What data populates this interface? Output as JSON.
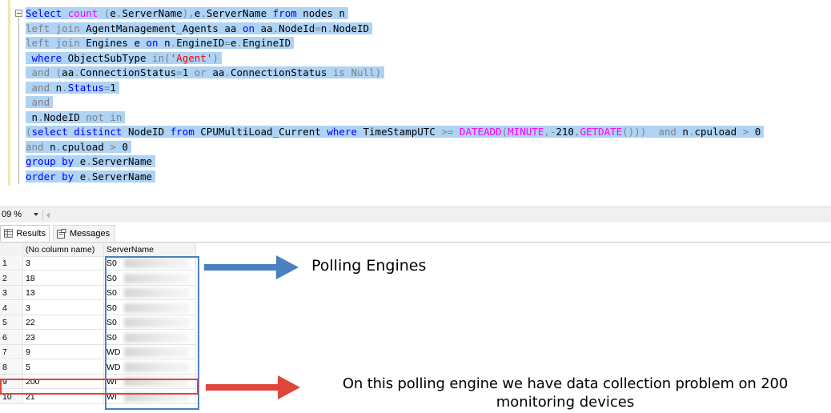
{
  "editor": {
    "lines": [
      [
        {
          "t": "Select ",
          "c": "kw"
        },
        {
          "t": "count",
          "c": "fn"
        },
        {
          "t": " (",
          "c": "gr"
        },
        {
          "t": "e",
          "c": "plain"
        },
        {
          "t": ".",
          "c": "gr"
        },
        {
          "t": "ServerName",
          "c": "plain"
        },
        {
          "t": "),",
          "c": "gr"
        },
        {
          "t": "e",
          "c": "plain"
        },
        {
          "t": ".",
          "c": "gr"
        },
        {
          "t": "ServerName ",
          "c": "plain"
        },
        {
          "t": "from",
          "c": "kw"
        },
        {
          "t": " nodes n",
          "c": "plain"
        }
      ],
      [
        {
          "t": "left join",
          "c": "gr"
        },
        {
          "t": " AgentManagement_Agents aa ",
          "c": "plain"
        },
        {
          "t": "on",
          "c": "kw"
        },
        {
          "t": " aa",
          "c": "plain"
        },
        {
          "t": ".",
          "c": "gr"
        },
        {
          "t": "NodeId",
          "c": "plain"
        },
        {
          "t": "=",
          "c": "gr"
        },
        {
          "t": "n",
          "c": "plain"
        },
        {
          "t": ".",
          "c": "gr"
        },
        {
          "t": "NodeID",
          "c": "plain"
        }
      ],
      [
        {
          "t": "left join",
          "c": "gr"
        },
        {
          "t": " Engines e ",
          "c": "plain"
        },
        {
          "t": "on",
          "c": "kw"
        },
        {
          "t": " n",
          "c": "plain"
        },
        {
          "t": ".",
          "c": "gr"
        },
        {
          "t": "EngineID",
          "c": "plain"
        },
        {
          "t": "=",
          "c": "gr"
        },
        {
          "t": "e",
          "c": "plain"
        },
        {
          "t": ".",
          "c": "gr"
        },
        {
          "t": "EngineID",
          "c": "plain"
        }
      ],
      [
        {
          "t": " where",
          "c": "kw"
        },
        {
          "t": " ObjectSubType ",
          "c": "plain"
        },
        {
          "t": "in",
          "c": "gr"
        },
        {
          "t": "(",
          "c": "gr"
        },
        {
          "t": "'Agent'",
          "c": "str"
        },
        {
          "t": ")",
          "c": "gr"
        }
      ],
      [
        {
          "t": " and",
          "c": "gr"
        },
        {
          "t": " (",
          "c": "gr"
        },
        {
          "t": "aa",
          "c": "plain"
        },
        {
          "t": ".",
          "c": "gr"
        },
        {
          "t": "ConnectionStatus",
          "c": "plain"
        },
        {
          "t": "=",
          "c": "gr"
        },
        {
          "t": "1 ",
          "c": "plain"
        },
        {
          "t": "or",
          "c": "gr"
        },
        {
          "t": " aa",
          "c": "plain"
        },
        {
          "t": ".",
          "c": "gr"
        },
        {
          "t": "ConnectionStatus ",
          "c": "plain"
        },
        {
          "t": "is Null",
          "c": "gr"
        },
        {
          "t": ")",
          "c": "gr"
        }
      ],
      [
        {
          "t": " and",
          "c": "gr"
        },
        {
          "t": " n",
          "c": "plain"
        },
        {
          "t": ".",
          "c": "gr"
        },
        {
          "t": "Status",
          "c": "kw"
        },
        {
          "t": "=",
          "c": "gr"
        },
        {
          "t": "1",
          "c": "plain"
        }
      ],
      [
        {
          "t": " and",
          "c": "gr"
        }
      ],
      [
        {
          "t": " n",
          "c": "plain"
        },
        {
          "t": ".",
          "c": "gr"
        },
        {
          "t": "NodeID ",
          "c": "plain"
        },
        {
          "t": "not in",
          "c": "gr"
        }
      ],
      [
        {
          "t": "(",
          "c": "gr"
        },
        {
          "t": "select distinct",
          "c": "kw"
        },
        {
          "t": " NodeID ",
          "c": "plain"
        },
        {
          "t": "from",
          "c": "kw"
        },
        {
          "t": " CPUMultiLoad_Current ",
          "c": "plain"
        },
        {
          "t": "where",
          "c": "kw"
        },
        {
          "t": " TimeStampUTC ",
          "c": "plain"
        },
        {
          "t": ">=",
          "c": "gr"
        },
        {
          "t": " DATEADD",
          "c": "fn"
        },
        {
          "t": "(",
          "c": "gr"
        },
        {
          "t": "MINUTE",
          "c": "fn"
        },
        {
          "t": ",-",
          "c": "gr"
        },
        {
          "t": "210",
          "c": "plain"
        },
        {
          "t": ",",
          "c": "gr"
        },
        {
          "t": "GETDATE",
          "c": "fn"
        },
        {
          "t": "()))",
          "c": "gr"
        },
        {
          "t": "  ",
          "c": "plain"
        },
        {
          "t": "and",
          "c": "gr"
        },
        {
          "t": " n",
          "c": "plain"
        },
        {
          "t": ".",
          "c": "gr"
        },
        {
          "t": "cpuload ",
          "c": "plain"
        },
        {
          "t": ">",
          "c": "gr"
        },
        {
          "t": " 0",
          "c": "plain"
        }
      ],
      [
        {
          "t": "and",
          "c": "gr"
        },
        {
          "t": " n",
          "c": "plain"
        },
        {
          "t": ".",
          "c": "gr"
        },
        {
          "t": "cpuload ",
          "c": "plain"
        },
        {
          "t": ">",
          "c": "gr"
        },
        {
          "t": " 0",
          "c": "plain"
        }
      ],
      [
        {
          "t": "group by",
          "c": "kw"
        },
        {
          "t": " e",
          "c": "plain"
        },
        {
          "t": ".",
          "c": "gr"
        },
        {
          "t": "ServerName",
          "c": "plain"
        }
      ],
      [
        {
          "t": "order by",
          "c": "kw"
        },
        {
          "t": " e",
          "c": "plain"
        },
        {
          "t": ".",
          "c": "gr"
        },
        {
          "t": "ServerName",
          "c": "plain"
        }
      ]
    ]
  },
  "zoom": {
    "value": "09 %"
  },
  "tabs": {
    "results_label": "Results",
    "messages_label": "Messages"
  },
  "grid": {
    "columns": [
      "",
      "(No column name)",
      "ServerName"
    ],
    "rows": [
      [
        "1",
        "3",
        "S0"
      ],
      [
        "2",
        "18",
        "S0"
      ],
      [
        "3",
        "13",
        "S0"
      ],
      [
        "4",
        "3",
        "S0"
      ],
      [
        "5",
        "22",
        "S0"
      ],
      [
        "6",
        "23",
        "S0"
      ],
      [
        "7",
        "9",
        "WD"
      ],
      [
        "8",
        "5",
        "WD"
      ],
      [
        "9",
        "200",
        "WI"
      ],
      [
        "10",
        "21",
        "WI"
      ]
    ]
  },
  "annotations": {
    "polling_engines": "Polling Engines",
    "problem_line1": "On this polling engine we have data collection problem on 200",
    "problem_line2": "monitoring devices"
  },
  "colors": {
    "blue_arrow": "#4a7fc1",
    "red_arrow": "#e0453a",
    "selection": "#aed3f5"
  }
}
